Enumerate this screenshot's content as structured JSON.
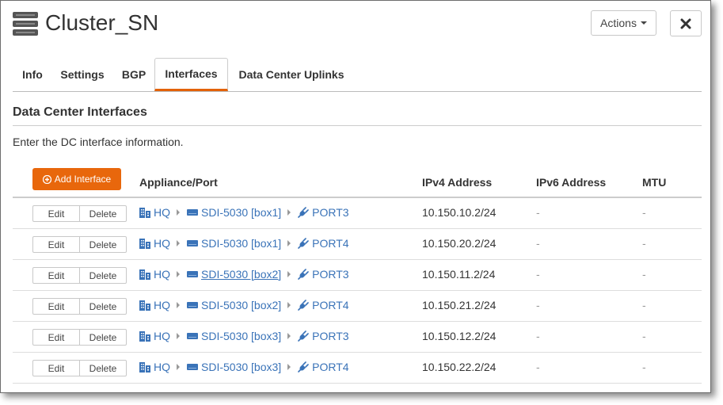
{
  "header": {
    "title": "Cluster_SN",
    "actions_label": "Actions",
    "close_icon": "close-icon"
  },
  "tabs": [
    {
      "label": "Info",
      "active": false
    },
    {
      "label": "Settings",
      "active": false
    },
    {
      "label": "BGP",
      "active": false
    },
    {
      "label": "Interfaces",
      "active": true
    },
    {
      "label": "Data Center Uplinks",
      "active": false
    }
  ],
  "section": {
    "title": "Data Center Interfaces",
    "description": "Enter the DC interface information."
  },
  "table": {
    "add_button_label": "Add Interface",
    "columns": {
      "port": "Appliance/Port",
      "ipv4": "IPv4 Address",
      "ipv6": "IPv6 Address",
      "mtu": "MTU"
    },
    "edit_label": "Edit",
    "delete_label": "Delete",
    "rows": [
      {
        "site": "HQ",
        "appliance": "SDI-5030 [box1]",
        "port": "PORT3",
        "ipv4": "10.150.10.2/24",
        "ipv6": "-",
        "mtu": "-"
      },
      {
        "site": "HQ",
        "appliance": "SDI-5030 [box1]",
        "port": "PORT4",
        "ipv4": "10.150.20.2/24",
        "ipv6": "-",
        "mtu": "-"
      },
      {
        "site": "HQ",
        "appliance": "SDI-5030 [box2]",
        "port": "PORT3",
        "ipv4": "10.150.11.2/24",
        "ipv6": "-",
        "mtu": "-"
      },
      {
        "site": "HQ",
        "appliance": "SDI-5030 [box2]",
        "port": "PORT4",
        "ipv4": "10.150.21.2/24",
        "ipv6": "-",
        "mtu": "-"
      },
      {
        "site": "HQ",
        "appliance": "SDI-5030 [box3]",
        "port": "PORT3",
        "ipv4": "10.150.12.2/24",
        "ipv6": "-",
        "mtu": "-"
      },
      {
        "site": "HQ",
        "appliance": "SDI-5030 [box3]",
        "port": "PORT4",
        "ipv4": "10.150.22.2/24",
        "ipv6": "-",
        "mtu": "-"
      }
    ]
  },
  "colors": {
    "accent": "#e8670c",
    "link": "#3a73b8"
  }
}
